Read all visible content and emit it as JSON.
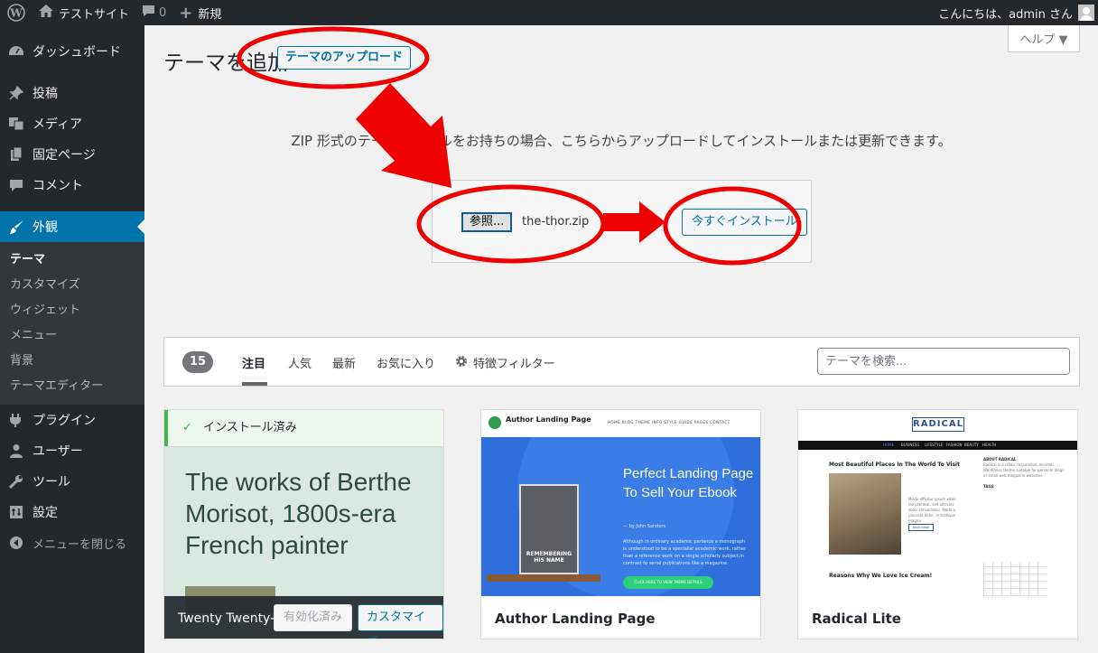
{
  "admin_bar": {
    "site_name": "テストサイト",
    "comments_count": "0",
    "new_label": "新規",
    "greeting": "こんにちは、admin さん"
  },
  "sidebar": {
    "items": [
      {
        "label": "ダッシュボード",
        "icon": "dashboard-icon"
      },
      {
        "label": "投稿",
        "icon": "pin-icon"
      },
      {
        "label": "メディア",
        "icon": "media-icon"
      },
      {
        "label": "固定ページ",
        "icon": "page-icon"
      },
      {
        "label": "コメント",
        "icon": "comment-icon"
      },
      {
        "label": "外観",
        "icon": "brush-icon"
      }
    ],
    "submenu": [
      "テーマ",
      "カスタマイズ",
      "ウィジェット",
      "メニュー",
      "背景",
      "テーマエディター"
    ],
    "items_after": [
      {
        "label": "プラグイン",
        "icon": "plugin-icon"
      },
      {
        "label": "ユーザー",
        "icon": "user-icon"
      },
      {
        "label": "ツール",
        "icon": "wrench-icon"
      },
      {
        "label": "設定",
        "icon": "settings-icon"
      }
    ],
    "collapse_label": "メニューを閉じる"
  },
  "page": {
    "title": "テーマを追加",
    "upload_button": "テーマのアップロード",
    "help_button": "ヘルプ ▼"
  },
  "upload": {
    "description": "ZIP 形式のテーマファイルをお持ちの場合、こちらからアップロードしてインストールまたは更新できます。",
    "browse_button": "参照...",
    "file_name": "the-thor.zip",
    "install_button": "今すぐインストール"
  },
  "filter": {
    "count": "15",
    "tabs": [
      "注目",
      "人気",
      "最新",
      "お気に入り"
    ],
    "feature_filter": "特徴フィルター",
    "search_placeholder": "テーマを検索..."
  },
  "themes": [
    {
      "installed_label": "インストール済み",
      "preview_text": "The works of Berthe Morisot, 1800s-era French painter",
      "name": "Twenty Twenty-One",
      "activated_label": "有効化済み",
      "customize_label": "カスタマイズ"
    },
    {
      "name": "Author Landing Page",
      "preview": {
        "site_title": "Author Landing Page",
        "nav": "HOME   BLOG   THEME INFO   STYLE GUIDE   PAGES   CONTACT",
        "headline": "Perfect Landing Page To Sell Your Ebook",
        "byline": "— by John Sanders",
        "body": "Although in ordinary academic parlance a monograph is understood to be a specialist academic work, rather than a reference work on a single scholarly subject,in contrast to serial publications like a magazine.",
        "cta": "CLICK HERE TO VIEW THEME DETAILS",
        "book_title": "REMEMBERING HIS NAME"
      }
    },
    {
      "name": "Radical Lite",
      "preview": {
        "logo": "RADICAL",
        "nav": [
          "HOME",
          "BUSINESS",
          "LIFESTYLE",
          "FASHION",
          "BEAUTY",
          "HEALTH"
        ],
        "post1": "Most Beautiful Places In The World To Visit",
        "post2": "Reasons Why We Love Ice Cream!",
        "read_more": "READ MORE",
        "excerpt": "Morbi efficitur ipsum vitae leo placerat, sed ultricies dolor consectetur. Morbi a placerat dolor, in tristique magna.",
        "sidebar_heading": "ABOUT RADICAL",
        "sidebar_text": "Radical is a clean, responsive, minimal WordPress theme suitable for personal blogs or small web magazine websites.",
        "tags_heading": "TAGS"
      }
    }
  ],
  "colors": {
    "admin_dark": "#23282d",
    "accent_blue": "#0073aa",
    "annotation_red": "#ee0000",
    "installed_green": "#46b450"
  }
}
